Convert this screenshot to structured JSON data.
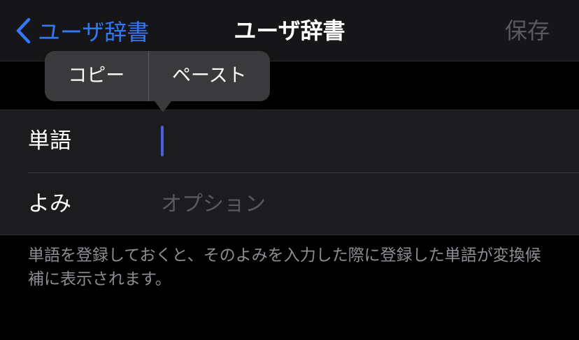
{
  "navbar": {
    "back_label": "ユーザ辞書",
    "title": "ユーザ辞書",
    "save_label": "保存"
  },
  "edit_menu": {
    "copy_label": "コピー",
    "paste_label": "ペースト"
  },
  "form": {
    "word": {
      "label": "単語",
      "value": ""
    },
    "reading": {
      "label": "よみ",
      "value": "",
      "placeholder": "オプション"
    }
  },
  "footer_text": "単語を登録しておくと、そのよみを入力した際に登録した単語が変換候補に表示されます。",
  "colors": {
    "accent": "#3478f6",
    "caret": "#4a5fe0",
    "disabled": "#5a5a5e",
    "footer_text": "#8d8d93"
  },
  "icons": {
    "back": "chevron-left-icon"
  }
}
